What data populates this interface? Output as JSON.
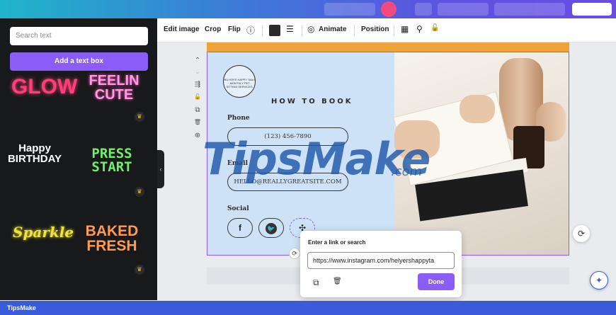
{
  "sidebar": {
    "search_placeholder": "Search text",
    "add_text_box": "Add a text box",
    "styles": [
      {
        "text": "GLOW",
        "color": "#ff3d7a"
      },
      {
        "text": "FEELIN CUTE",
        "color": "#ff9be0"
      },
      {
        "text": "Happy BIRTHDAY",
        "color": "#ffffff"
      },
      {
        "text": "PRESS START",
        "color": "#6ef06a"
      },
      {
        "text": "Sparkle",
        "color": "#f0e23a"
      },
      {
        "text": "BAKED FRESH",
        "color": "#ff9b54"
      }
    ],
    "premium_icon": "crown-icon",
    "crown_glyph": "♛",
    "collapse_glyph": "‹"
  },
  "toolbar": {
    "edit_image": "Edit image",
    "crop": "Crop",
    "flip": "Flip",
    "info_glyph": "ⓘ",
    "color_value": "#2a2a2a",
    "spacing_glyph": "☰",
    "animate": "Animate",
    "animate_glyph": "◎",
    "position": "Position",
    "transparency_glyph": "▦",
    "paint_glyph": "⚲",
    "lock_glyph": "🔓"
  },
  "side_tools": [
    "⌃",
    "⌄",
    "⇶",
    "🔓",
    "⧉",
    "🗑",
    "⊕"
  ],
  "design": {
    "logo_text": "HELYER'S HAPPY TAILS · MONTHLY PET-SITTING SERVICES",
    "heading": "HOW TO BOOK",
    "phone_label": "Phone",
    "phone_value": "(123) 456-7890",
    "email_label": "Email",
    "email_value": "HELLO@REALLYGREATSITE.COM",
    "social_label": "Social",
    "social_icons": [
      "f",
      "🐦",
      "✣"
    ]
  },
  "watermark": {
    "main": "TipsMake",
    "sub": ".com"
  },
  "rotate_glyph": "⟳",
  "link_popup": {
    "title": "Enter a link or search",
    "value": "https://www.instagram.com/helyershappyta",
    "copy_glyph": "⧉",
    "delete_glyph": "🗑",
    "done": "Done"
  },
  "fab": {
    "refresh_glyph": "⟳",
    "magic_glyph": "✦"
  },
  "footer": {
    "label": "TipsMake"
  },
  "colors": {
    "accent": "#8b5cf6",
    "footer": "#3a5bd9",
    "design_bg": "#cde2f6"
  }
}
